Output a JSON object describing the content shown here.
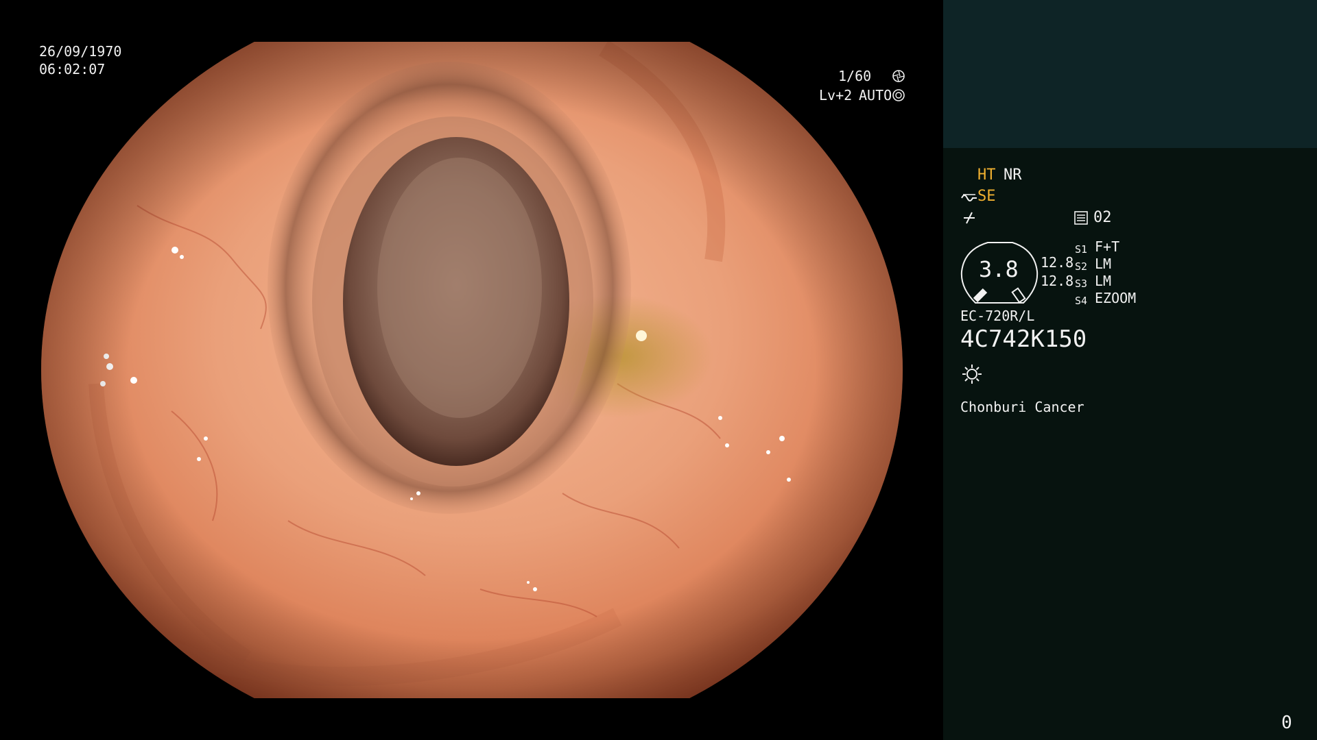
{
  "overlay": {
    "date": "26/09/1970",
    "time": "06:02:07",
    "shutter": "1/60",
    "level": "Lv+2",
    "exposure_mode": "AUTO"
  },
  "panel": {
    "modes": {
      "ht": "HT",
      "nr": "NR",
      "se": "SE"
    },
    "memory": "02",
    "zoom_value": "3.8",
    "zoom_top": "12.8",
    "zoom_bottom": "12.8",
    "switches": [
      {
        "key": "S1",
        "value": "F+T"
      },
      {
        "key": "S2",
        "value": "LM"
      },
      {
        "key": "S3",
        "value": "LM"
      },
      {
        "key": "S4",
        "value": "EZOOM"
      }
    ],
    "scope_model": "EC-720R/L",
    "serial": "4C742K150",
    "institution": "Chonburi Cancer",
    "counter": "0"
  },
  "icons": {
    "shutter": "aperture-icon",
    "exposure": "auto-exposure-icon",
    "structure": "structure-enhance-icon",
    "color": "color-tone-icon",
    "memory": "memory-card-icon",
    "light": "light-icon"
  },
  "colors": {
    "amber": "#f0b030",
    "panel_bg": "#07130f",
    "panel_top": "#0e2426"
  }
}
